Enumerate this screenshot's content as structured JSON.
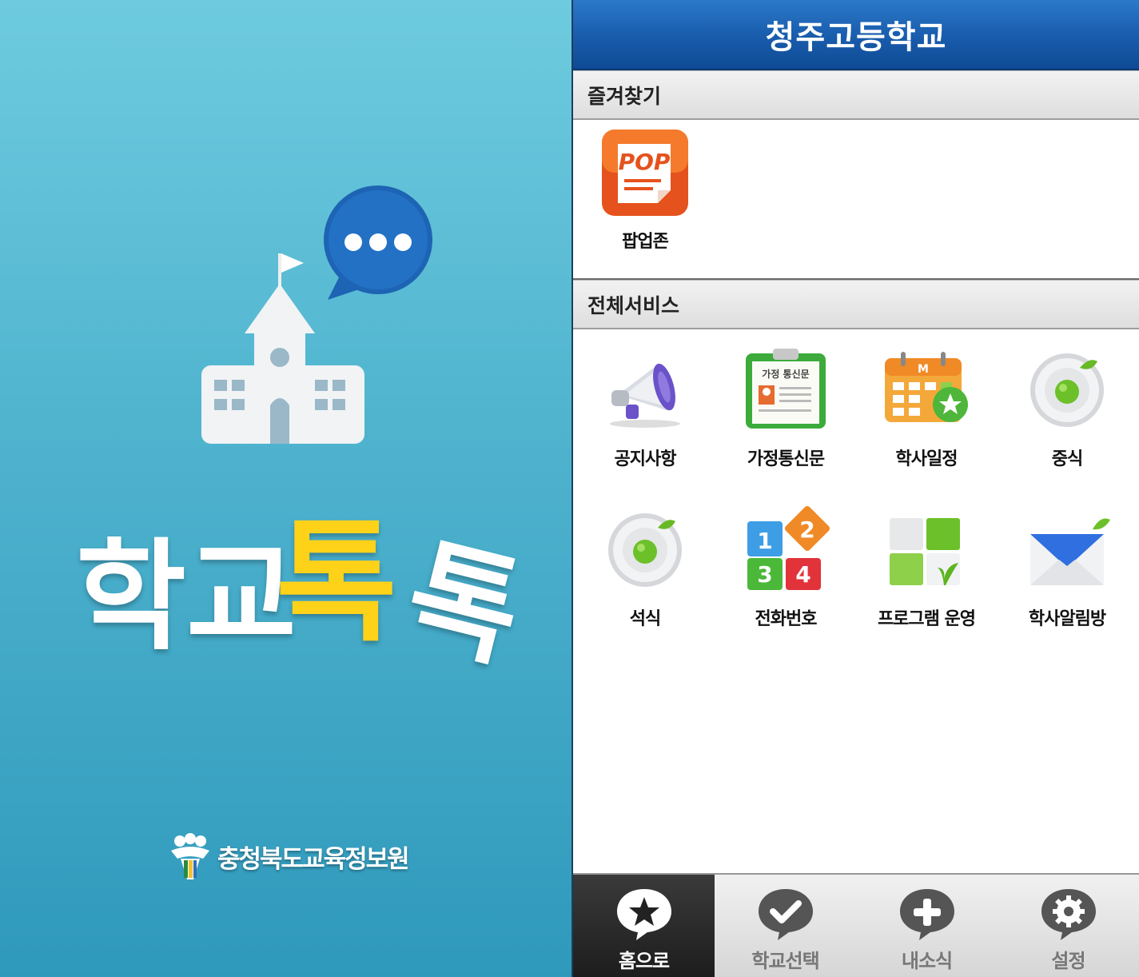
{
  "splash": {
    "title_part1": "학교",
    "title_part2": "톡",
    "title_part3": "톡",
    "org_name": "충청북도교육정보원",
    "colors": {
      "background": "#4fb3ce",
      "accent": "#ffd21a",
      "bubble": "#1d64b4"
    }
  },
  "header": {
    "school_name": "청주고등학교",
    "color": "#1a5eae"
  },
  "favorites": {
    "section_title": "즐겨찾기",
    "items": [
      {
        "label": "팝업존",
        "icon": "pop-icon",
        "icon_text": "POP"
      }
    ]
  },
  "services": {
    "section_title": "전체서비스",
    "items": [
      {
        "label": "공지사항",
        "icon": "megaphone-icon"
      },
      {
        "label": "가정통신문",
        "icon": "clipboard-icon",
        "icon_text": "가정 통신문"
      },
      {
        "label": "학사일정",
        "icon": "calendar-icon",
        "icon_text": "M"
      },
      {
        "label": "중식",
        "icon": "lunch-plate-icon"
      },
      {
        "label": "석식",
        "icon": "dinner-plate-icon"
      },
      {
        "label": "전화번호",
        "icon": "number-blocks-icon",
        "icon_text": [
          "1",
          "2",
          "3",
          "4"
        ]
      },
      {
        "label": "프로그램 운영",
        "icon": "program-blocks-icon"
      },
      {
        "label": "학사알림방",
        "icon": "envelope-icon"
      }
    ]
  },
  "bottom_nav": {
    "tabs": [
      {
        "label": "홈으로",
        "icon": "star-icon",
        "active": true
      },
      {
        "label": "학교선택",
        "icon": "check-icon",
        "active": false
      },
      {
        "label": "내소식",
        "icon": "plus-icon",
        "active": false
      },
      {
        "label": "설정",
        "icon": "gear-icon",
        "active": false
      }
    ]
  }
}
